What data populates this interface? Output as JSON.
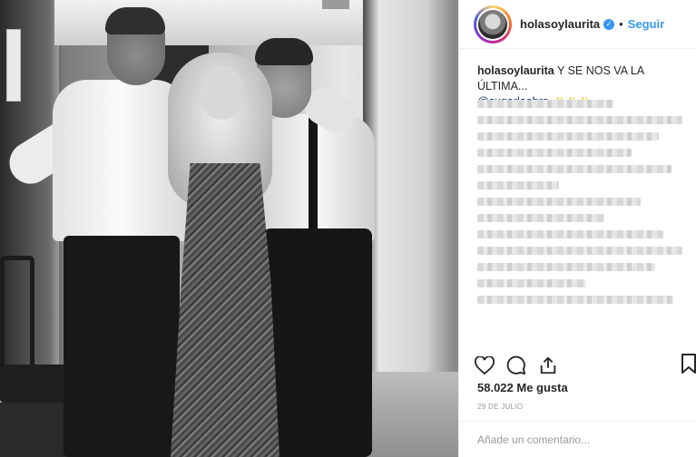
{
  "post": {
    "username": "holasoylaurita",
    "follow_label": "Seguir",
    "dot": "•",
    "caption_user": "holasoylaurita",
    "caption_text": "Y SE NOS VA LA ÚLTIMA...",
    "mention": "@sugarlaobra",
    "sparkles": "✨✨✨",
    "likes": "58.022 Me gusta",
    "date": "29 DE JULIO",
    "comment_placeholder": "Añade un comentario..."
  },
  "icons": {
    "verified": "verified-badge-icon",
    "like": "heart-icon",
    "comment": "comment-icon",
    "share": "share-icon",
    "save": "bookmark-icon"
  },
  "colors": {
    "accent": "#3897f0",
    "text": "#262626",
    "muted": "#999999",
    "border": "#efefef"
  }
}
